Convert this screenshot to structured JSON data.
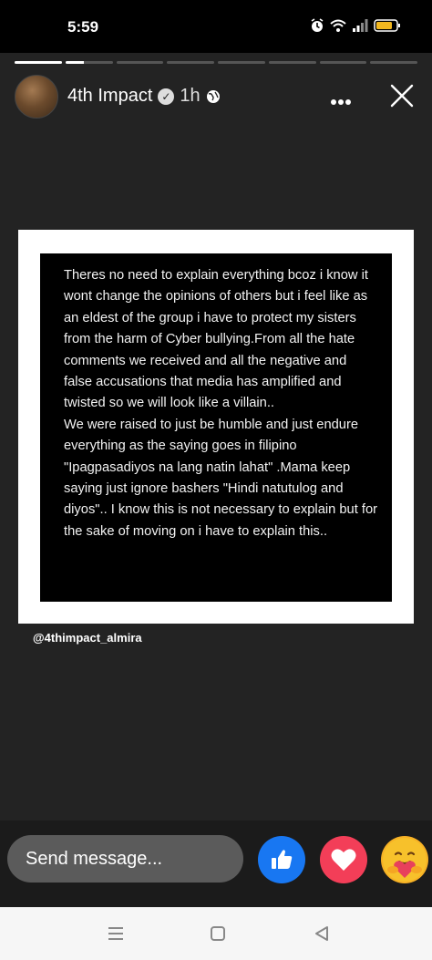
{
  "status_bar": {
    "time": "5:59",
    "icons": [
      "alarm-icon",
      "wifi-icon",
      "signal-icon",
      "battery-icon"
    ]
  },
  "story": {
    "progress_segments": 8,
    "active_segment_progress": 0.4,
    "author": "4th Impact",
    "time_ago": "1h",
    "post_text": "Theres no need to explain everything bcoz i know it wont change the opinions of others but i feel like as an eldest of the group i have to protect my sisters from the harm of Cyber bullying.From all the hate comments we received and all the negative and false accusations that media has amplified and twisted so we will look like a villain..\nWe were raised to just be humble and just endure everything as the saying goes in filipino \"Ipagpasadiyos na lang natin lahat\" .Mama keep saying just ignore bashers \"Hindi natutulog and diyos\".. I know this is not necessary to explain but for the sake of moving on i have to explain this..",
    "mention": "@4thimpact_almira"
  },
  "reply": {
    "placeholder": "Send message..."
  },
  "colors": {
    "background": "#232323",
    "like_blue": "#1877f2",
    "love_red": "#f33e58",
    "care_yellow": "#f7b125",
    "input_gray": "#5b5b5b"
  }
}
